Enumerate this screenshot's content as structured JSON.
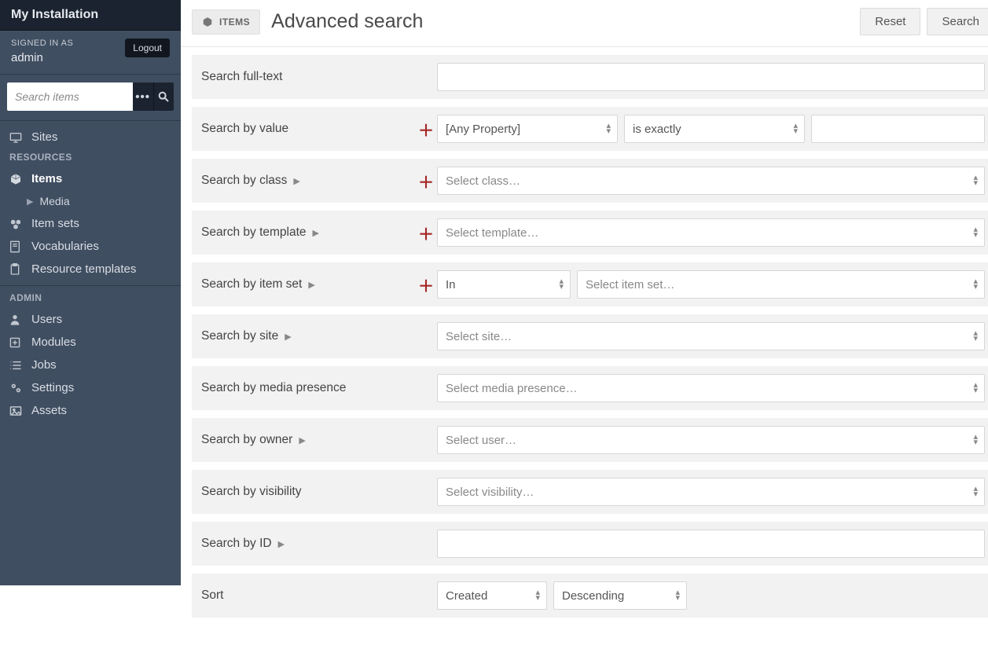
{
  "brand": "My Installation",
  "user": {
    "signed_label": "SIGNED IN AS",
    "name": "admin",
    "logout": "Logout"
  },
  "search": {
    "placeholder": "Search items"
  },
  "nav": {
    "sites": "Sites",
    "section_resources": "RESOURCES",
    "items": "Items",
    "media": "Media",
    "item_sets": "Item sets",
    "vocabularies": "Vocabularies",
    "resource_templates": "Resource templates",
    "section_admin": "ADMIN",
    "users": "Users",
    "modules": "Modules",
    "jobs": "Jobs",
    "settings": "Settings",
    "assets": "Assets"
  },
  "header": {
    "crumb": "ITEMS",
    "title": "Advanced search",
    "reset": "Reset",
    "search": "Search"
  },
  "form": {
    "fulltext": {
      "label": "Search full-text",
      "value": ""
    },
    "value": {
      "label": "Search by value",
      "property": "[Any Property]",
      "type": "is exactly",
      "text": ""
    },
    "class": {
      "label": "Search by class",
      "placeholder": "Select class…"
    },
    "template": {
      "label": "Search by template",
      "placeholder": "Select template…"
    },
    "itemset": {
      "label": "Search by item set",
      "in": "In",
      "placeholder": "Select item set…"
    },
    "site": {
      "label": "Search by site",
      "placeholder": "Select site…"
    },
    "media": {
      "label": "Search by media presence",
      "placeholder": "Select media presence…"
    },
    "owner": {
      "label": "Search by owner",
      "placeholder": "Select user…"
    },
    "visibility": {
      "label": "Search by visibility",
      "placeholder": "Select visibility…"
    },
    "id": {
      "label": "Search by ID",
      "value": ""
    },
    "sort": {
      "label": "Sort",
      "by": "Created",
      "dir": "Descending"
    }
  }
}
